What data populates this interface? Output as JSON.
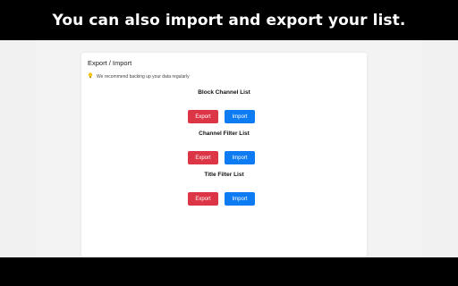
{
  "banner": {
    "text": "You can also import and export your list."
  },
  "card": {
    "title": "Export / Import",
    "tip": "We recommend backing up your data regularly",
    "sections": [
      {
        "title": "Block Channel List",
        "export_label": "Export",
        "import_label": "Import"
      },
      {
        "title": "Channel Filter List",
        "export_label": "Export",
        "import_label": "Import"
      },
      {
        "title": "Title Filter List",
        "export_label": "Export",
        "import_label": "Import"
      }
    ]
  },
  "colors": {
    "export": "#dc3545",
    "import": "#0d7cf2",
    "banner_bg": "#000000"
  },
  "icons": {
    "tip": "lightbulb-icon"
  }
}
